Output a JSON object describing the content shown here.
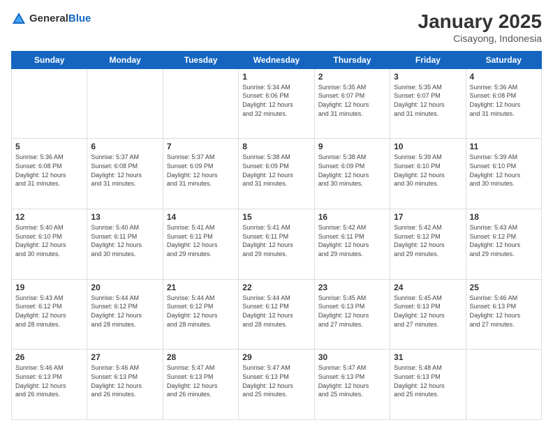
{
  "header": {
    "logo_general": "General",
    "logo_blue": "Blue",
    "month_title": "January 2025",
    "location": "Cisayong, Indonesia"
  },
  "weekdays": [
    "Sunday",
    "Monday",
    "Tuesday",
    "Wednesday",
    "Thursday",
    "Friday",
    "Saturday"
  ],
  "weeks": [
    [
      {
        "day": "",
        "info": ""
      },
      {
        "day": "",
        "info": ""
      },
      {
        "day": "",
        "info": ""
      },
      {
        "day": "1",
        "info": "Sunrise: 5:34 AM\nSunset: 6:06 PM\nDaylight: 12 hours\nand 32 minutes."
      },
      {
        "day": "2",
        "info": "Sunrise: 5:35 AM\nSunset: 6:07 PM\nDaylight: 12 hours\nand 31 minutes."
      },
      {
        "day": "3",
        "info": "Sunrise: 5:35 AM\nSunset: 6:07 PM\nDaylight: 12 hours\nand 31 minutes."
      },
      {
        "day": "4",
        "info": "Sunrise: 5:36 AM\nSunset: 6:08 PM\nDaylight: 12 hours\nand 31 minutes."
      }
    ],
    [
      {
        "day": "5",
        "info": "Sunrise: 5:36 AM\nSunset: 6:08 PM\nDaylight: 12 hours\nand 31 minutes."
      },
      {
        "day": "6",
        "info": "Sunrise: 5:37 AM\nSunset: 6:08 PM\nDaylight: 12 hours\nand 31 minutes."
      },
      {
        "day": "7",
        "info": "Sunrise: 5:37 AM\nSunset: 6:09 PM\nDaylight: 12 hours\nand 31 minutes."
      },
      {
        "day": "8",
        "info": "Sunrise: 5:38 AM\nSunset: 6:09 PM\nDaylight: 12 hours\nand 31 minutes."
      },
      {
        "day": "9",
        "info": "Sunrise: 5:38 AM\nSunset: 6:09 PM\nDaylight: 12 hours\nand 30 minutes."
      },
      {
        "day": "10",
        "info": "Sunrise: 5:39 AM\nSunset: 6:10 PM\nDaylight: 12 hours\nand 30 minutes."
      },
      {
        "day": "11",
        "info": "Sunrise: 5:39 AM\nSunset: 6:10 PM\nDaylight: 12 hours\nand 30 minutes."
      }
    ],
    [
      {
        "day": "12",
        "info": "Sunrise: 5:40 AM\nSunset: 6:10 PM\nDaylight: 12 hours\nand 30 minutes."
      },
      {
        "day": "13",
        "info": "Sunrise: 5:40 AM\nSunset: 6:11 PM\nDaylight: 12 hours\nand 30 minutes."
      },
      {
        "day": "14",
        "info": "Sunrise: 5:41 AM\nSunset: 6:11 PM\nDaylight: 12 hours\nand 29 minutes."
      },
      {
        "day": "15",
        "info": "Sunrise: 5:41 AM\nSunset: 6:11 PM\nDaylight: 12 hours\nand 29 minutes."
      },
      {
        "day": "16",
        "info": "Sunrise: 5:42 AM\nSunset: 6:11 PM\nDaylight: 12 hours\nand 29 minutes."
      },
      {
        "day": "17",
        "info": "Sunrise: 5:42 AM\nSunset: 6:12 PM\nDaylight: 12 hours\nand 29 minutes."
      },
      {
        "day": "18",
        "info": "Sunrise: 5:43 AM\nSunset: 6:12 PM\nDaylight: 12 hours\nand 29 minutes."
      }
    ],
    [
      {
        "day": "19",
        "info": "Sunrise: 5:43 AM\nSunset: 6:12 PM\nDaylight: 12 hours\nand 28 minutes."
      },
      {
        "day": "20",
        "info": "Sunrise: 5:44 AM\nSunset: 6:12 PM\nDaylight: 12 hours\nand 28 minutes."
      },
      {
        "day": "21",
        "info": "Sunrise: 5:44 AM\nSunset: 6:12 PM\nDaylight: 12 hours\nand 28 minutes."
      },
      {
        "day": "22",
        "info": "Sunrise: 5:44 AM\nSunset: 6:12 PM\nDaylight: 12 hours\nand 28 minutes."
      },
      {
        "day": "23",
        "info": "Sunrise: 5:45 AM\nSunset: 6:13 PM\nDaylight: 12 hours\nand 27 minutes."
      },
      {
        "day": "24",
        "info": "Sunrise: 5:45 AM\nSunset: 6:13 PM\nDaylight: 12 hours\nand 27 minutes."
      },
      {
        "day": "25",
        "info": "Sunrise: 5:46 AM\nSunset: 6:13 PM\nDaylight: 12 hours\nand 27 minutes."
      }
    ],
    [
      {
        "day": "26",
        "info": "Sunrise: 5:46 AM\nSunset: 6:13 PM\nDaylight: 12 hours\nand 26 minutes."
      },
      {
        "day": "27",
        "info": "Sunrise: 5:46 AM\nSunset: 6:13 PM\nDaylight: 12 hours\nand 26 minutes."
      },
      {
        "day": "28",
        "info": "Sunrise: 5:47 AM\nSunset: 6:13 PM\nDaylight: 12 hours\nand 26 minutes."
      },
      {
        "day": "29",
        "info": "Sunrise: 5:47 AM\nSunset: 6:13 PM\nDaylight: 12 hours\nand 25 minutes."
      },
      {
        "day": "30",
        "info": "Sunrise: 5:47 AM\nSunset: 6:13 PM\nDaylight: 12 hours\nand 25 minutes."
      },
      {
        "day": "31",
        "info": "Sunrise: 5:48 AM\nSunset: 6:13 PM\nDaylight: 12 hours\nand 25 minutes."
      },
      {
        "day": "",
        "info": ""
      }
    ]
  ]
}
